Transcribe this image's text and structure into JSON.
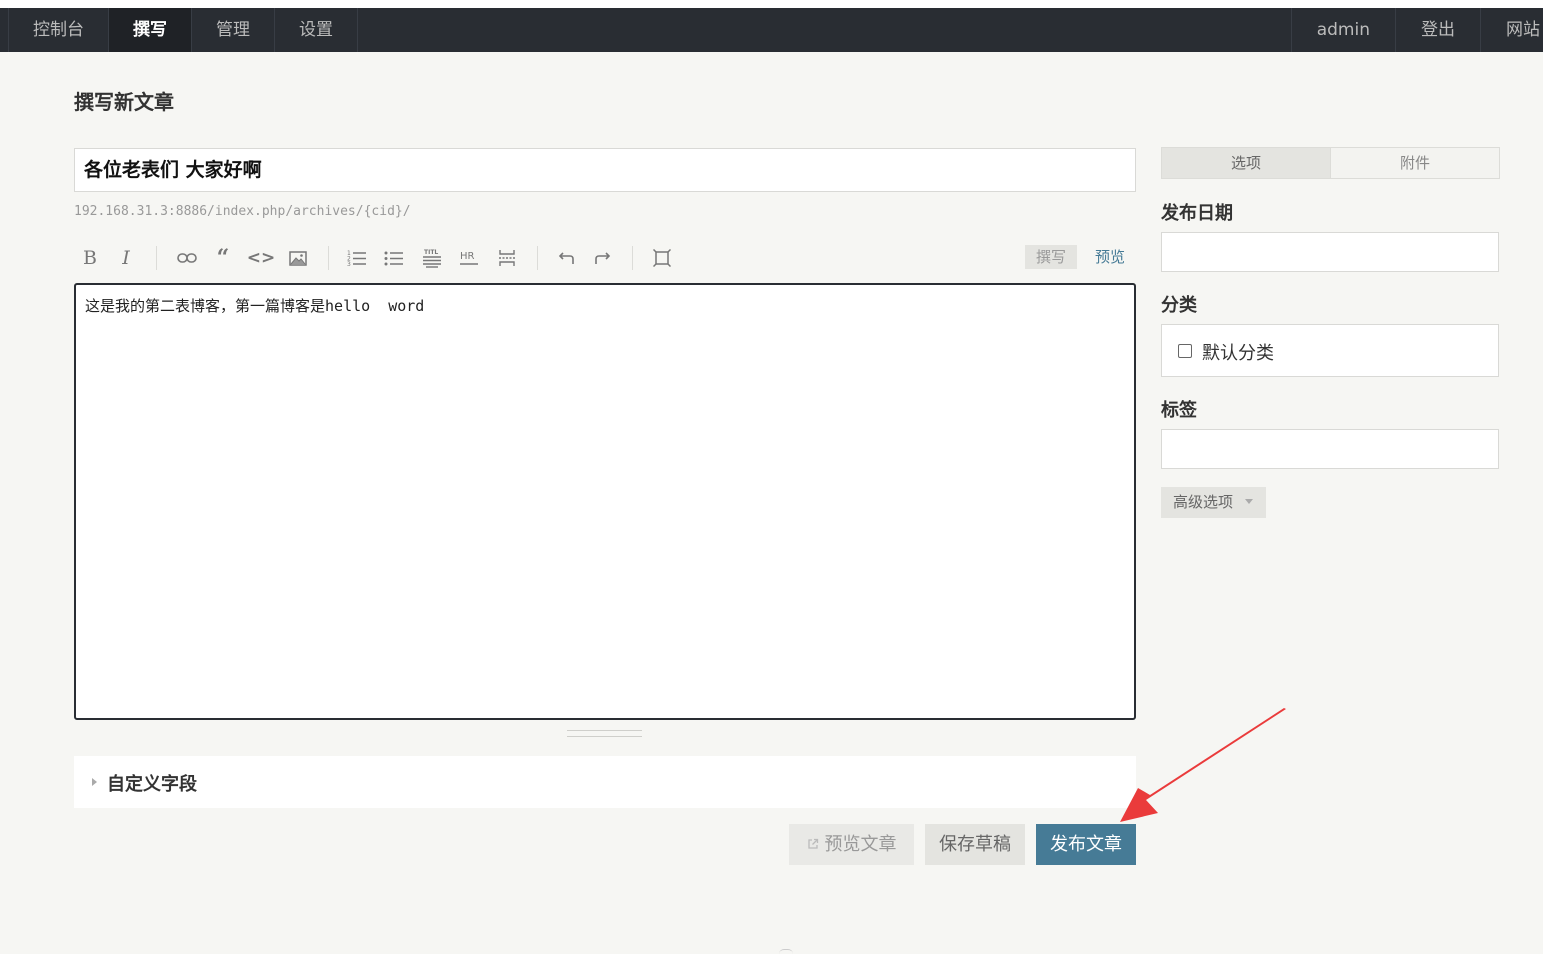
{
  "nav": {
    "left": [
      "控制台",
      "撰写",
      "管理",
      "设置"
    ],
    "user": "admin",
    "logout": "登出",
    "site": "网站"
  },
  "page": {
    "title": "撰写新文章"
  },
  "post": {
    "title": "各位老表们 大家好啊",
    "permalink": "192.168.31.3:8886/index.php/archives/{cid}/",
    "content": "这是我的第二表博客，第一篇博客是hello  word"
  },
  "toolbar": {
    "bold": "B",
    "italic": "I",
    "mode_write": "撰写",
    "mode_preview": "预览"
  },
  "custom_fields": {
    "label": "自定义字段"
  },
  "actions": {
    "preview": "预览文章",
    "save_draft": "保存草稿",
    "publish": "发布文章"
  },
  "sidebar": {
    "tabs": [
      "选项",
      "附件"
    ],
    "date_label": "发布日期",
    "category_label": "分类",
    "category_option": "默认分类",
    "tags_label": "标签",
    "advanced": "高级选项"
  },
  "colors": {
    "navbar": "#292d33",
    "accent": "#467b96",
    "annotation_arrow": "#ea3b3b"
  }
}
